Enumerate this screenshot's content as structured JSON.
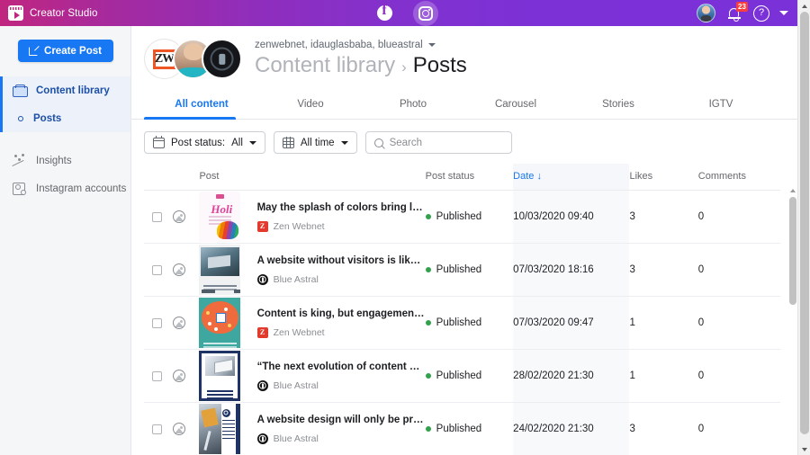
{
  "topbar": {
    "brand": "Creator Studio",
    "brand_icon": "creator-studio-logo-icon",
    "facebook_icon": "facebook-icon",
    "instagram_icon": "instagram-icon",
    "notification_badge": "23",
    "help_label": "?",
    "accent_gradient_from": "#c0267f",
    "accent_gradient_to": "#7a31d8"
  },
  "sidebar": {
    "create_post_label": "Create Post",
    "items": [
      {
        "label": "Content library",
        "icon": "content-library-icon",
        "selected": true
      },
      {
        "label": "Posts",
        "icon": "posts-dot-icon",
        "selected": true
      },
      {
        "label": "Insights",
        "icon": "insights-icon",
        "selected": false
      },
      {
        "label": "Instagram accounts",
        "icon": "instagram-accounts-icon",
        "selected": false
      }
    ]
  },
  "account_header": {
    "accounts_label": "zenwebnet, idauglasbaba, blueastral",
    "avatars": [
      "zen-webnet-avatar",
      "idauglasbaba-avatar",
      "blue-astral-avatar"
    ],
    "breadcrumb_parent": "Content library",
    "breadcrumb_separator": "›",
    "breadcrumb_current": "Posts"
  },
  "tabs": [
    {
      "label": "All content",
      "active": true
    },
    {
      "label": "Video",
      "active": false
    },
    {
      "label": "Photo",
      "active": false
    },
    {
      "label": "Carousel",
      "active": false
    },
    {
      "label": "Stories",
      "active": false
    },
    {
      "label": "IGTV",
      "active": false
    }
  ],
  "filters": {
    "post_status_label": "Post status:",
    "post_status_value": "All",
    "time_range_value": "All time",
    "search_placeholder": "Search",
    "search_value": ""
  },
  "table": {
    "columns": {
      "post": "Post",
      "post_status": "Post status",
      "date": "Date",
      "date_sort_arrow": "↓",
      "likes": "Likes",
      "comments": "Comments"
    },
    "rows": [
      {
        "title": "May the splash of colors bring love...",
        "account": "Zen Webnet",
        "account_badge": "Z",
        "status": "Published",
        "date": "10/03/2020 09:40",
        "likes": "3",
        "comments": "0"
      },
      {
        "title": "A website without visitors is like an...",
        "account": "Blue Astral",
        "account_badge": "",
        "status": "Published",
        "date": "07/03/2020 18:16",
        "likes": "3",
        "comments": "0"
      },
      {
        "title": "Content is king, but engagement is ...",
        "account": "Zen Webnet",
        "account_badge": "Z",
        "status": "Published",
        "date": "07/03/2020 09:47",
        "likes": "1",
        "comments": "0"
      },
      {
        "title": "“The next evolution of content mar...",
        "account": "Blue Astral",
        "account_badge": "",
        "status": "Published",
        "date": "28/02/2020 21:30",
        "likes": "1",
        "comments": "0"
      },
      {
        "title": "A website design will only be prais...",
        "account": "Blue Astral",
        "account_badge": "",
        "status": "Published",
        "date": "24/02/2020 21:30",
        "likes": "3",
        "comments": "0"
      }
    ]
  },
  "colors": {
    "primary_blue": "#1877f2",
    "published_green": "#31a24c",
    "badge_red": "#fa3e3e"
  }
}
